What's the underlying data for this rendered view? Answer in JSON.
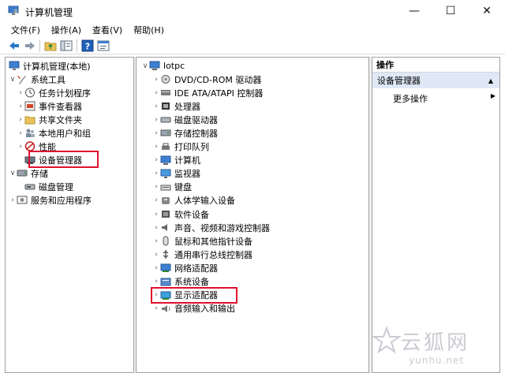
{
  "window": {
    "title": "计算机管理",
    "icon": "computer-management-icon",
    "controls": {
      "minimize": "—",
      "maximize": "☐",
      "close": "✕"
    }
  },
  "menu": [
    "文件(F)",
    "操作(A)",
    "查看(V)",
    "帮助(H)"
  ],
  "toolbar": {
    "icons": [
      "back-arrow-icon",
      "forward-arrow-icon",
      "up-folder-icon",
      "show-hide-tree-icon",
      "help-icon",
      "properties-icon"
    ]
  },
  "tree": {
    "root": "计算机管理(本地)",
    "system_tools": "系统工具",
    "items": [
      "任务计划程序",
      "事件查看器",
      "共享文件夹",
      "本地用户和组",
      "性能",
      "设备管理器"
    ],
    "storage": "存储",
    "disk_management": "磁盘管理",
    "services": "服务和应用程序"
  },
  "devices": {
    "root": "lotpc",
    "list": [
      "DVD/CD-ROM 驱动器",
      "IDE ATA/ATAPI 控制器",
      "处理器",
      "磁盘驱动器",
      "存储控制器",
      "打印队列",
      "计算机",
      "监视器",
      "键盘",
      "人体学输入设备",
      "软件设备",
      "声音、视频和游戏控制器",
      "鼠标和其他指针设备",
      "通用串行总线控制器",
      "网络适配器",
      "系统设备",
      "显示适配器",
      "音频输入和输出"
    ]
  },
  "actions": {
    "header": "操作",
    "section": "设备管理器",
    "more": "更多操作",
    "expand_arrow": "▲",
    "more_arrow": "▶"
  },
  "watermark": {
    "text": "云狐网",
    "url": "yunhu.net"
  },
  "colors": {
    "highlight": "#e0102f",
    "selected_section": "#dfe8f6"
  }
}
